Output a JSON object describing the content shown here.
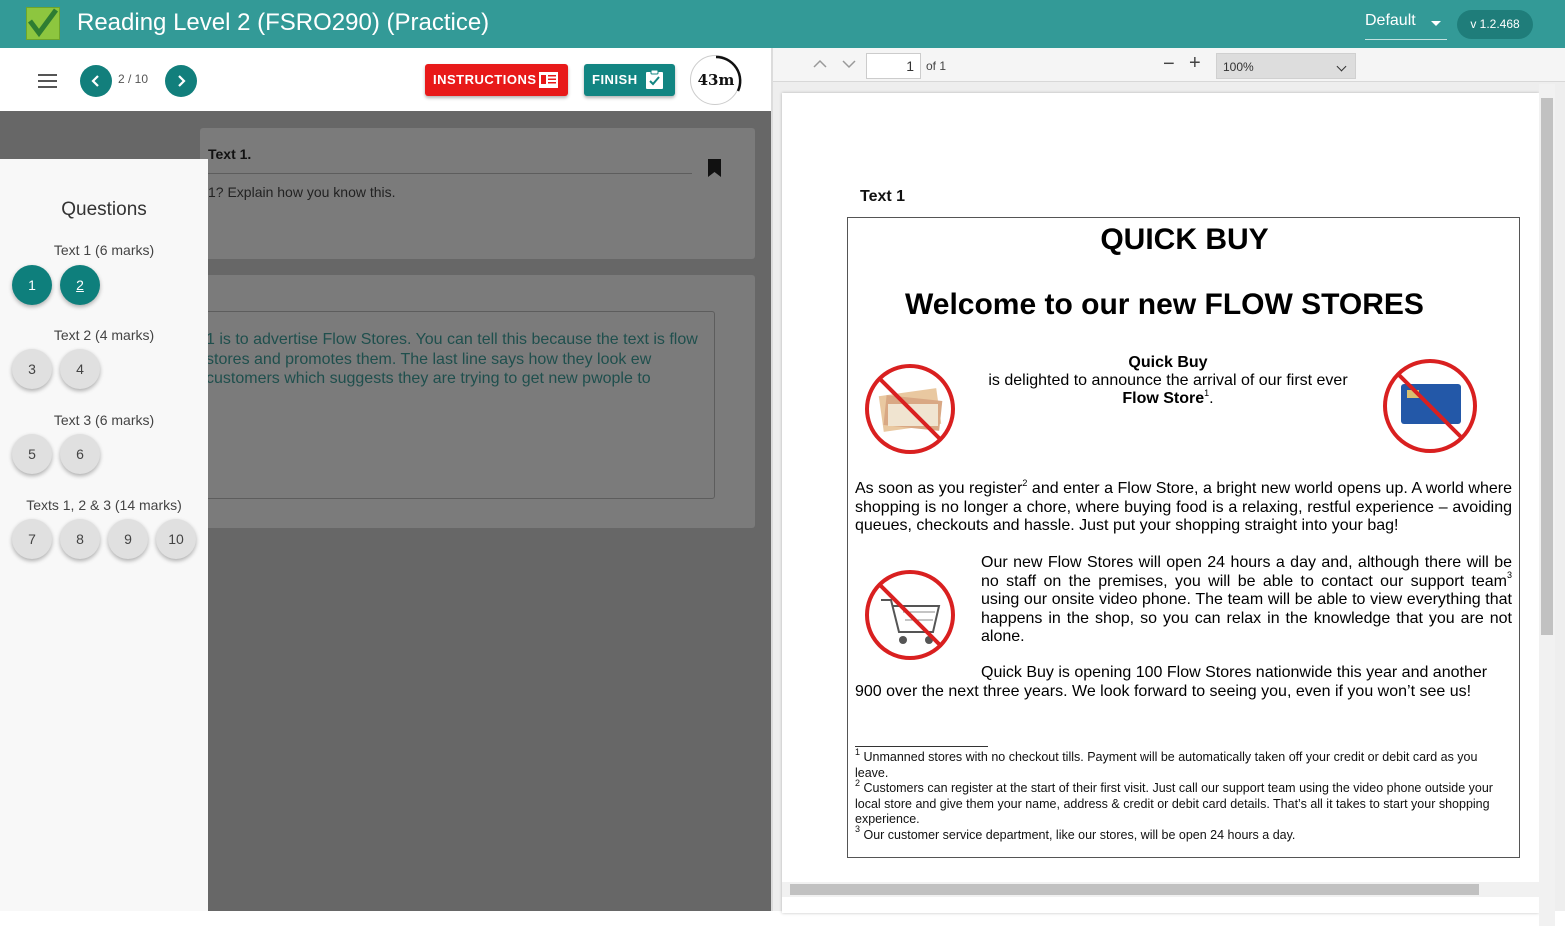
{
  "header": {
    "title": "Reading Level 2 (FSRO290) (Practice)",
    "profile": "Default",
    "version": "v 1.2.468"
  },
  "toolbar": {
    "page_counter": "2 / 10",
    "instructions_label": "INSTRUCTIONS",
    "finish_label": "FINISH",
    "timer": "43m"
  },
  "sidebar": {
    "title": "Questions",
    "groups": [
      {
        "label": "Text 1 (6 marks)",
        "questions": [
          "1",
          "2"
        ]
      },
      {
        "label": "Text 2 (4 marks)",
        "questions": [
          "3",
          "4"
        ]
      },
      {
        "label": "Text 3 (6 marks)",
        "questions": [
          "5",
          "6"
        ]
      },
      {
        "label": "Texts 1, 2 & 3 (14 marks)",
        "questions": [
          "7",
          "8",
          "9",
          "10"
        ]
      }
    ]
  },
  "question": {
    "heading": "Text 1.",
    "text": "1? Explain how you know this."
  },
  "answer": {
    "text": "1 is to advertise Flow Stores. You can tell this because the text is flow stores and promotes them. The last line says how they look ew customers which suggests they are trying to get new pwople to"
  },
  "pdf": {
    "page": "1",
    "of": "of 1",
    "zoom": "100%",
    "doc": {
      "label": "Text 1",
      "heading": "QUICK BUY",
      "welcome": "Welcome to our new FLOW STORES",
      "announce_brand": "Quick Buy",
      "announce_line": "is delighted to announce the arrival of our first ever",
      "announce_store": "Flow Store",
      "para1_a": "As soon as you register",
      "para1_b": " and enter a Flow Store, a bright new world opens up.  A world where shopping is no longer a chore, where buying food is a relaxing, restful experience – avoiding queues, checkouts and hassle. Just put your shopping straight into your bag!",
      "para2_a": "Our new Flow Stores will open 24 hours a day and, although there will be no staff on the premises, you will be able to contact our support team",
      "para2_b": " using our onsite video phone. The team will be able to view everything that happens in the shop, so you can relax in the knowledge that you are not alone.",
      "para3_a": "Quick Buy is opening 100 Flow Stores nationwide this year and another",
      "para3_b": "900 over the next three years. We look forward to seeing you, even if you won’t see us!",
      "footnote1": " Unmanned stores with no checkout tills. Payment will be automatically taken off your credit or debit card as you leave.",
      "footnote2": " Customers can register at the start of their first visit. Just call our support team using the video phone outside your local store and give them your name, address & credit or debit card details. That’s all it takes to start your shopping experience.",
      "footnote3": " Our customer service department, like our stores, will be open 24 hours a day.",
      "sup1": "1",
      "sup2": "2",
      "sup3": "3"
    }
  },
  "colors": {
    "brand": "#339a97",
    "accent": "#127f7c",
    "danger": "#e81919"
  }
}
